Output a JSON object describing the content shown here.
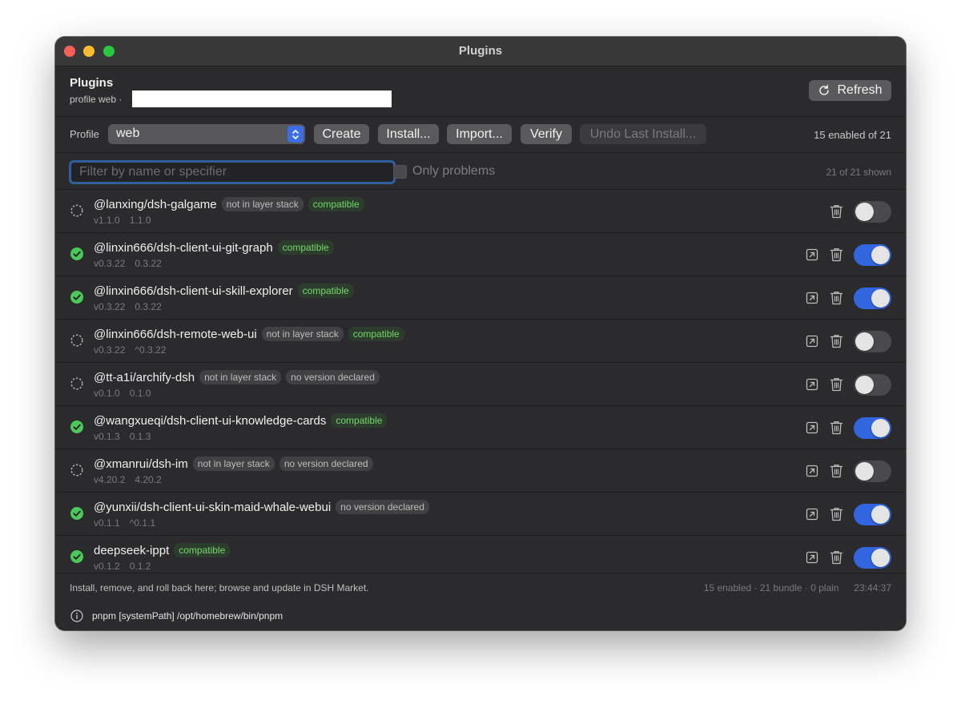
{
  "window": {
    "title": "Plugins"
  },
  "header": {
    "title": "Plugins",
    "subtitle": "profile web ·",
    "refresh_label": "Refresh"
  },
  "toolbar": {
    "profile_label": "Profile",
    "profile_value": "web",
    "create_label": "Create",
    "install_label": "Install...",
    "import_label": "Import...",
    "verify_label": "Verify",
    "undo_label": "Undo Last Install...",
    "enabled_count": "15 enabled of 21"
  },
  "filter": {
    "placeholder": "Filter by name or specifier",
    "value": "",
    "only_problems_label": "Only problems",
    "only_problems_checked": false,
    "shown_count": "21 of 21 shown"
  },
  "plugins": [
    {
      "name": "@lanxing/dsh-galgame",
      "enabled": false,
      "badges": [
        {
          "text": "not in layer stack",
          "kind": "neutral"
        },
        {
          "text": "compatible",
          "kind": "ok"
        }
      ],
      "version": "v1.1.0",
      "spec": "1.1.0",
      "has_link": false
    },
    {
      "name": "@linxin666/dsh-client-ui-git-graph",
      "enabled": true,
      "badges": [
        {
          "text": "compatible",
          "kind": "ok"
        }
      ],
      "version": "v0.3.22",
      "spec": "0.3.22",
      "has_link": true
    },
    {
      "name": "@linxin666/dsh-client-ui-skill-explorer",
      "enabled": true,
      "badges": [
        {
          "text": "compatible",
          "kind": "ok"
        }
      ],
      "version": "v0.3.22",
      "spec": "0.3.22",
      "has_link": true
    },
    {
      "name": "@linxin666/dsh-remote-web-ui",
      "enabled": false,
      "badges": [
        {
          "text": "not in layer stack",
          "kind": "neutral"
        },
        {
          "text": "compatible",
          "kind": "ok"
        }
      ],
      "version": "v0.3.22",
      "spec": "^0.3.22",
      "has_link": true
    },
    {
      "name": "@tt-a1i/archify-dsh",
      "enabled": false,
      "badges": [
        {
          "text": "not in layer stack",
          "kind": "neutral"
        },
        {
          "text": "no version declared",
          "kind": "neutral"
        }
      ],
      "version": "v0.1.0",
      "spec": "0.1.0",
      "has_link": true
    },
    {
      "name": "@wangxueqi/dsh-client-ui-knowledge-cards",
      "enabled": true,
      "badges": [
        {
          "text": "compatible",
          "kind": "ok"
        }
      ],
      "version": "v0.1.3",
      "spec": "0.1.3",
      "has_link": true
    },
    {
      "name": "@xmanrui/dsh-im",
      "enabled": false,
      "badges": [
        {
          "text": "not in layer stack",
          "kind": "neutral"
        },
        {
          "text": "no version declared",
          "kind": "neutral"
        }
      ],
      "version": "v4.20.2",
      "spec": "4.20.2",
      "has_link": true
    },
    {
      "name": "@yunxii/dsh-client-ui-skin-maid-whale-webui",
      "enabled": true,
      "badges": [
        {
          "text": "no version declared",
          "kind": "neutral"
        }
      ],
      "version": "v0.1.1",
      "spec": "^0.1.1",
      "has_link": true
    },
    {
      "name": "deepseek-ippt",
      "enabled": true,
      "badges": [
        {
          "text": "compatible",
          "kind": "ok"
        }
      ],
      "version": "v0.1.2",
      "spec": "0.1.2",
      "has_link": true
    }
  ],
  "footer": {
    "hint": "Install, remove, and roll back here; browse and update in DSH Market.",
    "stats": "15 enabled · 21 bundle · 0 plain",
    "time": "23:44:37"
  },
  "statusbar": {
    "text": "pnpm [systemPath] /opt/homebrew/bin/pnpm"
  },
  "colors": {
    "accent": "#3266e0",
    "ok_green": "#74d66a",
    "status_ok": "#4cc85a"
  }
}
